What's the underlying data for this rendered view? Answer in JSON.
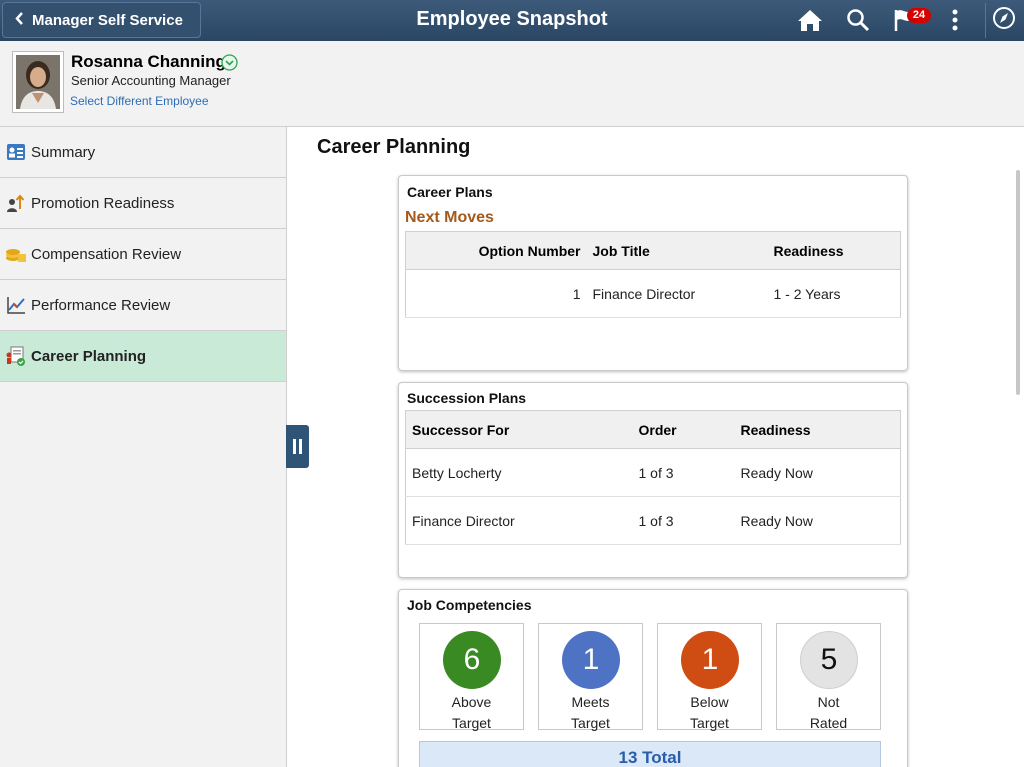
{
  "header": {
    "back_label": "Manager Self Service",
    "title": "Employee Snapshot",
    "icons": [
      "home-icon",
      "search-icon",
      "flag-icon",
      "more-icon",
      "navigator-icon"
    ],
    "notification_count": "24"
  },
  "employee": {
    "name": "Rosanna Channing",
    "title": "Senior Accounting Manager",
    "select_link": "Select Different Employee"
  },
  "sidebar": {
    "items": [
      {
        "label": "Summary",
        "icon": "summary-icon"
      },
      {
        "label": "Promotion Readiness",
        "icon": "promotion-icon"
      },
      {
        "label": "Compensation Review",
        "icon": "compensation-icon"
      },
      {
        "label": "Performance Review",
        "icon": "performance-icon"
      },
      {
        "label": "Career Planning",
        "icon": "career-planning-icon",
        "active": true
      }
    ]
  },
  "main": {
    "heading": "Career Planning",
    "career_plans": {
      "title": "Career Plans",
      "subheading": "Next Moves",
      "columns": [
        "Option Number",
        "Job Title",
        "Readiness"
      ],
      "rows": [
        {
          "option_number": "1",
          "job_title": "Finance Director",
          "readiness": "1 - 2 Years"
        }
      ]
    },
    "succession_plans": {
      "title": "Succession Plans",
      "columns": [
        "Successor For",
        "Order",
        "Readiness"
      ],
      "rows": [
        {
          "successor_for": "Betty Locherty",
          "order": "1 of 3",
          "readiness": "Ready Now"
        },
        {
          "successor_for": "Finance Director",
          "order": "1 of 3",
          "readiness": "Ready Now"
        }
      ]
    },
    "job_competencies": {
      "title": "Job Competencies",
      "tiles": [
        {
          "count": "6",
          "line1": "Above",
          "line2": "Target",
          "color": "#3a8a24"
        },
        {
          "count": "1",
          "line1": "Meets",
          "line2": "Target",
          "color": "#4f73c4"
        },
        {
          "count": "1",
          "line1": "Below",
          "line2": "Target",
          "color": "#cf4d12"
        },
        {
          "count": "5",
          "line1": "Not",
          "line2": "Rated",
          "color": "#e3e3e3"
        }
      ],
      "total": "13 Total"
    }
  },
  "colors": {
    "header_bg": "#2f4e6e",
    "active_nav": "#c8ead6",
    "link": "#2d6db5",
    "subheading": "#a45a1a"
  }
}
